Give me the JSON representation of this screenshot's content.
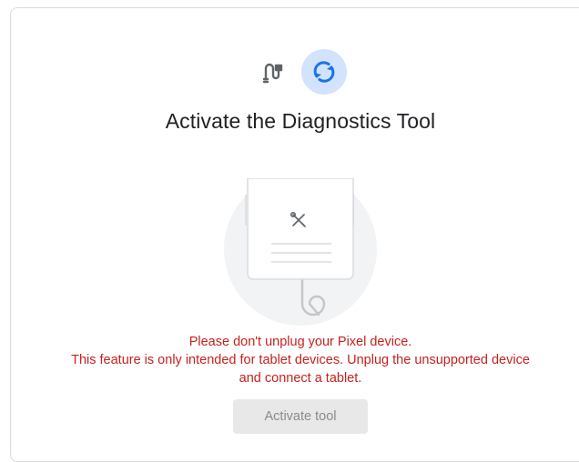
{
  "title": "Activate the Diagnostics Tool",
  "messages": {
    "line1": "Please don't unplug your Pixel device.",
    "line2": "This feature is only intended for tablet devices. Unplug the unsupported device",
    "line3": "and connect a tablet."
  },
  "activate_button": {
    "label": "Activate tool",
    "enabled": false
  },
  "icons": {
    "step_connect": "cable-icon",
    "step_sync": "sync-icon",
    "illustration_tool": "tools-icon"
  },
  "colors": {
    "error_text": "#c5221f",
    "sync_accent": "#1a73e8",
    "sync_bg": "#d3e3fd",
    "button_disabled_bg": "#e8e8e8"
  }
}
